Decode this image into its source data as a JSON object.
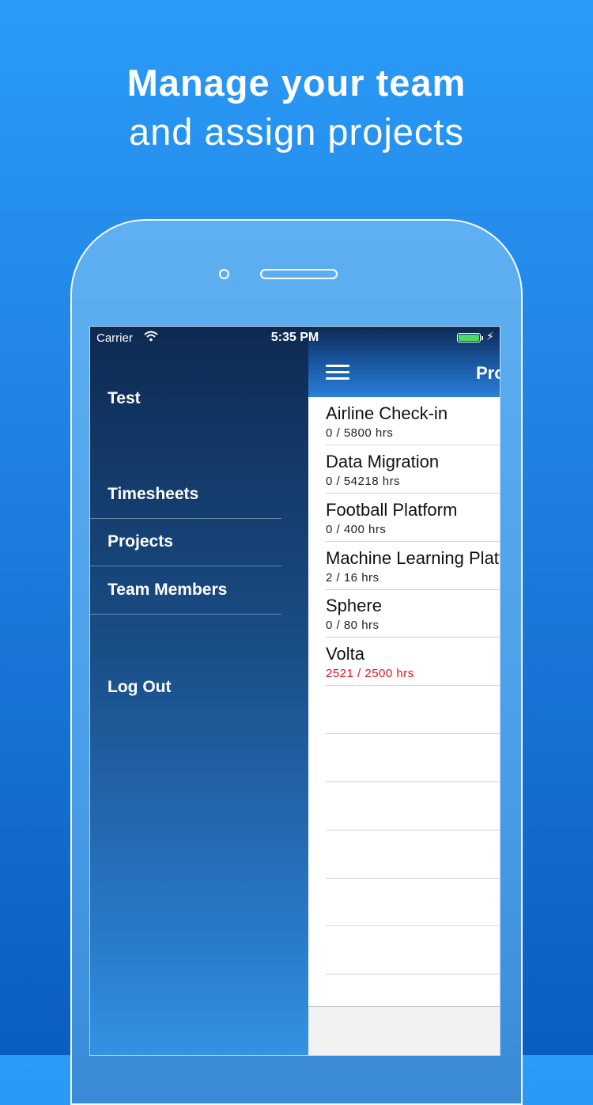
{
  "headline": {
    "line1": "Manage your team",
    "line2": "and assign projects"
  },
  "status_bar": {
    "carrier": "Carrier",
    "time": "5:35 PM",
    "battery_level": 1.0,
    "battery_color": "#4cd964"
  },
  "drawer": {
    "user": "Test",
    "items": [
      {
        "label": "Timesheets"
      },
      {
        "label": "Projects"
      },
      {
        "label": "Team Members"
      }
    ],
    "logout": "Log Out"
  },
  "navbar": {
    "title": "Projects",
    "menu_icon": "hamburger-icon"
  },
  "projects": [
    {
      "name": "Airline Check-in",
      "hours": "0 / 5800 hrs",
      "over_budget": false
    },
    {
      "name": "Data Migration",
      "hours": "0 / 54218 hrs",
      "over_budget": false
    },
    {
      "name": "Football Platform",
      "hours": "0 / 400 hrs",
      "over_budget": false
    },
    {
      "name": "Machine Learning Platform",
      "hours": "2 / 16 hrs",
      "over_budget": false
    },
    {
      "name": "Sphere",
      "hours": "0 / 80 hrs",
      "over_budget": false
    },
    {
      "name": "Volta",
      "hours": "2521 / 2500 hrs",
      "over_budget": true
    }
  ],
  "colors": {
    "over_budget": "#e8101c",
    "background_top": "#2b9bf8",
    "background_bottom": "#0a5ec0"
  }
}
